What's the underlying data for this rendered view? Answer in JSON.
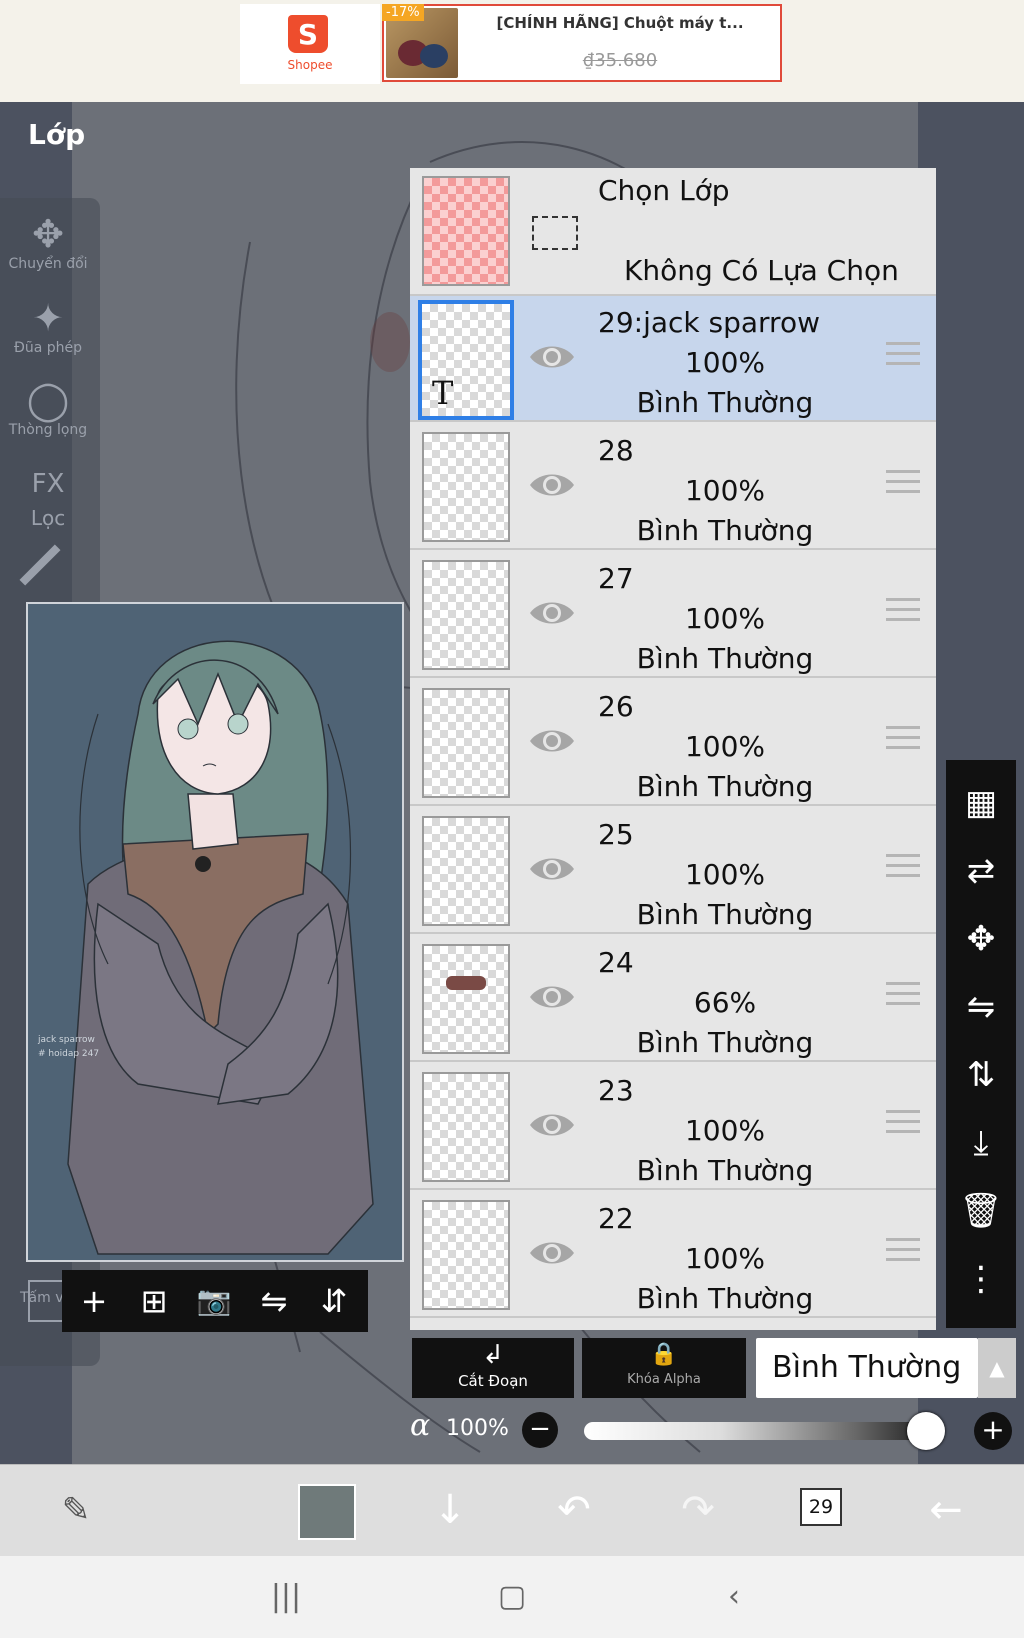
{
  "ad": {
    "menu_icon": "≡",
    "brand": "Shopee",
    "brand_letter": "S",
    "discount": "-17%",
    "product_title": "[CHÍNH HÃNG] Chuột máy t...",
    "price": "₫35.680"
  },
  "panel": {
    "title": "Lớp"
  },
  "left_tools": [
    {
      "label": "Chuyển đổi",
      "icon": "✥",
      "icon_name": "move-arrows-icon"
    },
    {
      "label": "Đũa phép",
      "icon": "✦",
      "icon_name": "magic-wand-icon"
    },
    {
      "label": "Thòng lọng",
      "icon": "◯",
      "icon_name": "lasso-icon"
    },
    {
      "label": "Lọc",
      "icon": "FX",
      "icon_name": "fx-filter-icon"
    },
    {
      "label": "Tấm vải",
      "icon": "",
      "icon_name": "canvas-icon"
    }
  ],
  "preview": {
    "caption_line1": "jack sparrow",
    "caption_line2": "# hoidap 247"
  },
  "preview_toolbar": [
    {
      "icon": "+",
      "name": "add-layer-icon"
    },
    {
      "icon": "⊞",
      "name": "add-layer-box-icon"
    },
    {
      "icon": "📷",
      "name": "camera-icon"
    },
    {
      "icon": "⇋",
      "name": "flip-horizontal-icon"
    },
    {
      "icon": "⇵",
      "name": "flip-vertical-icon"
    }
  ],
  "select_layer": {
    "title": "Chọn Lớp",
    "subtitle": "Không Có Lựa Chọn"
  },
  "layers": [
    {
      "name": "29:jack sparrow",
      "opacity": "100%",
      "mode": "Bình Thường",
      "selected": true,
      "text_layer": "T"
    },
    {
      "name": "28",
      "opacity": "100%",
      "mode": "Bình Thường",
      "selected": false
    },
    {
      "name": "27",
      "opacity": "100%",
      "mode": "Bình Thường",
      "selected": false
    },
    {
      "name": "26",
      "opacity": "100%",
      "mode": "Bình Thường",
      "selected": false
    },
    {
      "name": "25",
      "opacity": "100%",
      "mode": "Bình Thường",
      "selected": false
    },
    {
      "name": "24",
      "opacity": "66%",
      "mode": "Bình Thường",
      "selected": false
    },
    {
      "name": "23",
      "opacity": "100%",
      "mode": "Bình Thường",
      "selected": false
    },
    {
      "name": "22",
      "opacity": "100%",
      "mode": "Bình Thường",
      "selected": false
    }
  ],
  "right_tools": [
    {
      "icon": "▦",
      "name": "transparent-fill-icon"
    },
    {
      "icon": "⇄",
      "name": "swap-layer-icon"
    },
    {
      "icon": "✥",
      "name": "move-icon"
    },
    {
      "icon": "⇋",
      "name": "flip-horizontal-icon"
    },
    {
      "icon": "⇅",
      "name": "flip-vertical-icon"
    },
    {
      "icon": "⤓",
      "name": "merge-down-icon"
    },
    {
      "icon": "🗑",
      "name": "trash-icon"
    },
    {
      "icon": "⋮",
      "name": "more-icon"
    }
  ],
  "controls": {
    "clip_label": "Cắt Đoạn",
    "clip_icon": "↲",
    "alpha_lock_label": "Khóa Alpha",
    "alpha_lock_icon": "🔒",
    "blend_mode": "Bình Thường",
    "alpha_symbol": "α",
    "alpha_value": "100%",
    "opacity_level": 1.0
  },
  "bottom_bar": {
    "layer_count": "29",
    "current_color": "#6f7a7a"
  }
}
